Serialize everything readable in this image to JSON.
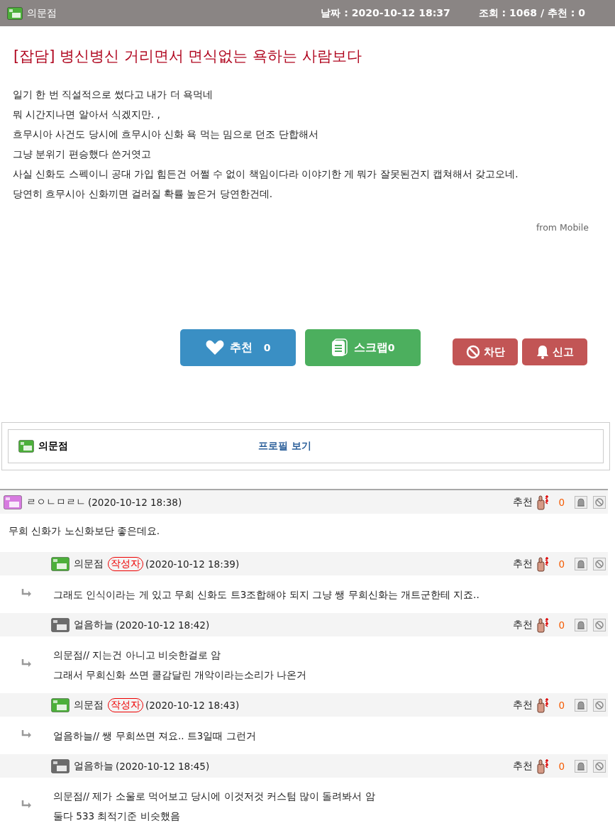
{
  "header": {
    "author": "의문점",
    "date_label": "날짜 : 2020-10-12 18:37",
    "stats_label": "조회 : 1068 / 추천 : 0"
  },
  "post": {
    "title": "[잡담] 병신병신 거리면서 면식없는 욕하는 사람보다",
    "body": [
      "일기 한 번 직설적으로 썼다고 내가 더 욕먹네",
      "뭐 시간지나면 알아서 식겠지만. ,",
      "흐무시아 사건도 당시에 흐무시아 신화 욕 먹는 밈으로 던조 단합해서",
      "그냥 분위기 편승했다 쓴거엿고",
      "사실 신화도 스펙이니 공대 가입 힘든건 어쩔 수 없이 책임이다라 이야기한 게 뭐가 잘못된건지 캡쳐해서 갖고오네.",
      "당연히 흐무시아 신화끼면 걸러질 확률 높은거 당연한건데."
    ],
    "source": "from Mobile"
  },
  "actions": [
    {
      "kind": "recommend",
      "label": "추천",
      "count": "0"
    },
    {
      "kind": "scrap",
      "label": "스크랩",
      "count": "0"
    },
    {
      "kind": "block",
      "label": "차단"
    },
    {
      "kind": "report",
      "label": "신고"
    }
  ],
  "profile": {
    "name": "의문점",
    "link": "프로필 보기"
  },
  "comments": [
    {
      "kind": "comment",
      "color": "#d77be0",
      "user": "ㄹㅇㄴㅁㄹㄴ",
      "is_author": false,
      "date": "(2020-10-12 18:38)",
      "recommend_label": "추천",
      "count": "0",
      "body": [
        "무희 신화가 노신화보단 좋은데요."
      ]
    },
    {
      "kind": "reply",
      "color": "#4caf3a",
      "user": "의문점",
      "is_author": true,
      "author_tag": "작성자",
      "date": "(2020-10-12 18:39)",
      "recommend_label": "추천",
      "count": "0",
      "body": [
        "그래도 인식이라는 게 있고 무희 신화도 트3조합해야 되지 그냥 쌩 무희신화는 개트군한테 지죠.."
      ]
    },
    {
      "kind": "reply",
      "color": "#6b6b6b",
      "user": "얼음하늘",
      "is_author": false,
      "date": "(2020-10-12 18:42)",
      "recommend_label": "추천",
      "count": "0",
      "body": [
        "의문점// 지는건 아니고 비슷한걸로 암",
        "그래서 무희신화 쓰면 쿨감달린 개악이라는소리가 나온거"
      ]
    },
    {
      "kind": "reply",
      "color": "#4caf3a",
      "user": "의문점",
      "is_author": true,
      "author_tag": "작성자",
      "date": "(2020-10-12 18:43)",
      "recommend_label": "추천",
      "count": "0",
      "body": [
        "얼음하늘// 쌩 무희쓰면 져요.. 트3일때 그런거"
      ]
    },
    {
      "kind": "reply",
      "color": "#6b6b6b",
      "user": "얼음하늘",
      "is_author": false,
      "date": "(2020-10-12 18:45)",
      "recommend_label": "추천",
      "count": "0",
      "body": [
        "의문점// 제가 소울로 먹어보고 당시에 이것저것 커스텀 많이 돌려봐서 암",
        "둘다 533 최적기준 비슷했음"
      ]
    }
  ]
}
